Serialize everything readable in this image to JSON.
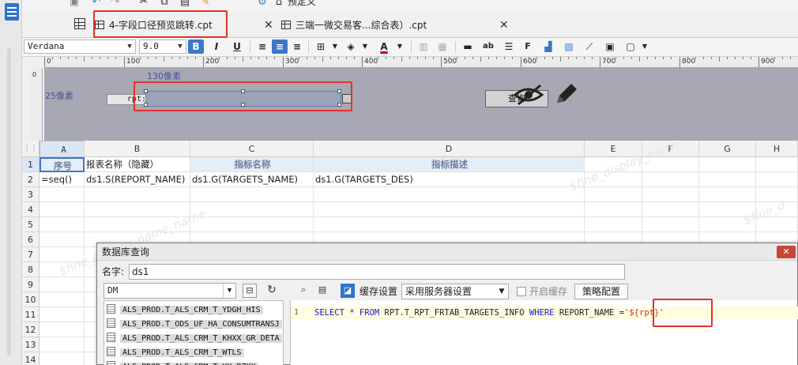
{
  "tabs": [
    {
      "label": "4-字段口径预览跳转.cpt",
      "active": true
    },
    {
      "label": "三端一微交易客...综合表）.cpt",
      "active": false
    }
  ],
  "topbar": {
    "partial_label": "预定义"
  },
  "format": {
    "font": "Verdana",
    "size": "9.0",
    "bold": "B",
    "italic": "I",
    "underline": "U"
  },
  "ruler": {
    "marks": [
      "0",
      "100",
      "200",
      "300",
      "400",
      "500",
      "600",
      "700",
      "800",
      "900"
    ]
  },
  "param_pane": {
    "width_annotation": "130像素",
    "height_annotation": "25像素",
    "rpt_label": "rpt:",
    "query_button": "查询"
  },
  "grid": {
    "columns": [
      "A",
      "B",
      "C",
      "D",
      "E",
      "F",
      "G",
      "H"
    ],
    "rows": [
      "1",
      "2",
      "3",
      "4",
      "5",
      "6",
      "7",
      "8",
      "9",
      "10",
      "11",
      "12",
      "13",
      "14"
    ],
    "row1": [
      "序号",
      "报表名称（隐藏）",
      "指标名称",
      "指标描述"
    ],
    "row2": [
      "=seq()",
      "ds1.S(REPORT_NAME)",
      "ds1.G(TARGETS_NAME)",
      "ds1.G(TARGETS_DES)"
    ]
  },
  "dialog": {
    "title": "数据库查询",
    "name_label": "名字:",
    "name_value": "ds1",
    "db_select": "DM",
    "cache_label": "缓存设置",
    "cache_select": "采用服务器设置",
    "enable_cache": "开启缓存",
    "strategy_button": "策略配置",
    "tables": [
      "ALS_PROD.T_ALS_CRM_T_YDGH_HIS",
      "ALS_PROD.T_ODS_UF_HA_CONSUMTRANSJ",
      "ALS_PROD.T_ALS_CRM_T_KHXX_GR_DETA",
      "ALS_PROD.T_ALS_CRM_T_WTLS",
      "ALS_PROD.T_ALS_CRM_T_YY_RZXX"
    ],
    "sql_line_number": "1",
    "sql": {
      "select": "SELECT",
      "star": "*",
      "from": "FROM",
      "table": "RPT.T_RPT_FRTAB_TARGETS_INFO",
      "where": "WHERE",
      "column": "REPORT_NAME",
      "op": "=",
      "param": "'${rpt}'"
    }
  },
  "colors": {
    "highlight": "#e5302a",
    "accent": "#3b78c8",
    "param_bg": "#a7a8b3"
  }
}
